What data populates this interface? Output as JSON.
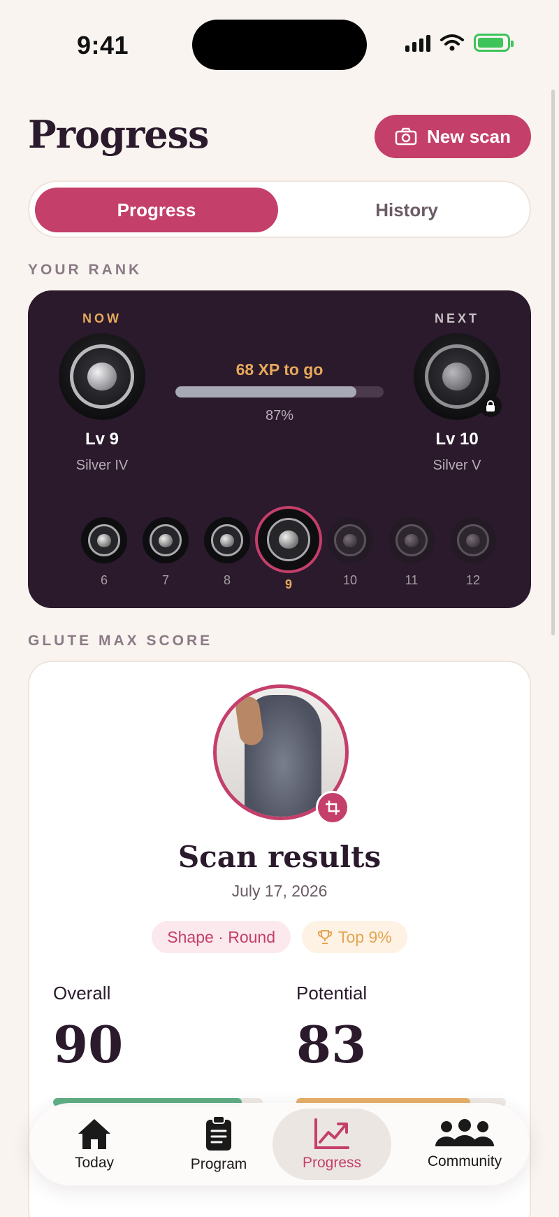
{
  "status": {
    "time": "9:41"
  },
  "header": {
    "title": "Progress",
    "new_scan_label": "New scan"
  },
  "segment": {
    "active": "Progress",
    "inactive": "History"
  },
  "rank": {
    "section_label": "YOUR RANK",
    "now_tag": "NOW",
    "next_tag": "NEXT",
    "current_level": "Lv 9",
    "current_tier": "Silver IV",
    "next_level": "Lv 10",
    "next_tier": "Silver V",
    "xp_to_go": "68 XP to go",
    "progress_percent": "87%",
    "progress_value": 0.87,
    "levels": [
      "6",
      "7",
      "8",
      "9",
      "10",
      "11",
      "12"
    ],
    "current_index": 3
  },
  "score": {
    "section_label": "GLUTE MAX SCORE",
    "title": "Scan results",
    "date": "July 17, 2026",
    "shape_chip": "Shape · Round",
    "top_chip": "Top 9%",
    "overall_label": "Overall",
    "overall_value": "90",
    "overall_progress": 0.9,
    "potential_label": "Potential",
    "potential_value": "83",
    "potential_progress": 0.83
  },
  "tabs": {
    "today": "Today",
    "program": "Program",
    "progress": "Progress",
    "community": "Community"
  },
  "colors": {
    "accent": "#c43f6a",
    "gold": "#e7a95b",
    "green": "#5fae86",
    "card_dark": "#2a1a2c",
    "background": "#f9f4f0"
  }
}
